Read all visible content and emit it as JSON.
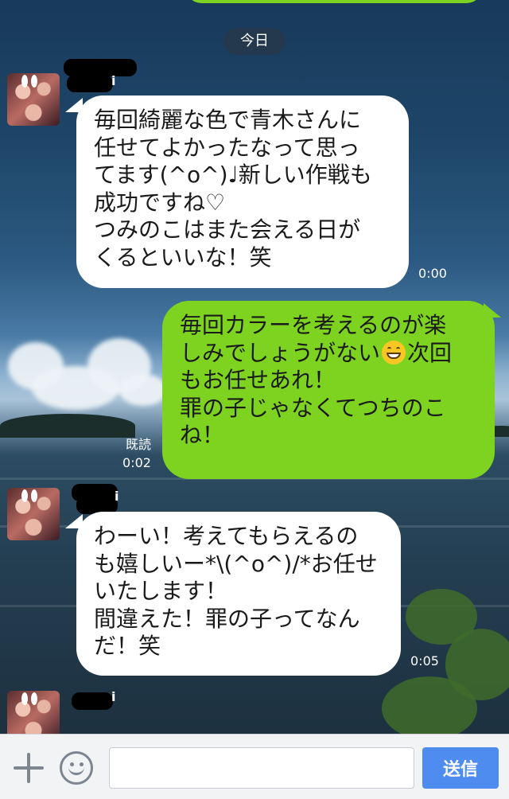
{
  "chat": {
    "date_separator": "今日",
    "messages": [
      {
        "sender_name_visible": "i",
        "lines": [
          "毎回綺麗な色で青木さんに",
          "任せてよかったなって思っ",
          "てます(^o^)♩新しい作戦も",
          "成功ですね♡",
          "つみのこはまた会える日が",
          "くるといいな！笑"
        ],
        "time": "0:00"
      },
      {
        "lines_before_emoji": "しみでしょうがない",
        "line1": "毎回カラーを考えるのが楽",
        "emoji": "grinning-face-emoji",
        "line2_after_emoji": "次回",
        "line3": "もお任せあれ！",
        "line4": "罪の子じゃなくてつちのこ",
        "line5": "ね！",
        "read_label": "既読",
        "time": "0:02"
      },
      {
        "sender_name_visible": "i",
        "lines": [
          "わーい！考えてもらえるの",
          "も嬉しいー*\\(^o^)/*お任せ",
          "いたします！",
          "間違えた！罪の子ってなん",
          "だ！笑"
        ],
        "time": "0:05"
      },
      {
        "sender_name_visible": "i"
      }
    ]
  },
  "composer": {
    "plus_icon": "plus-icon",
    "sticker_icon": "smile-icon",
    "input_value": "",
    "send_label": "送信"
  },
  "colors": {
    "outgoing_bubble": "#7ed321",
    "incoming_bubble": "#ffffff",
    "send_button": "#4f8cf0"
  }
}
